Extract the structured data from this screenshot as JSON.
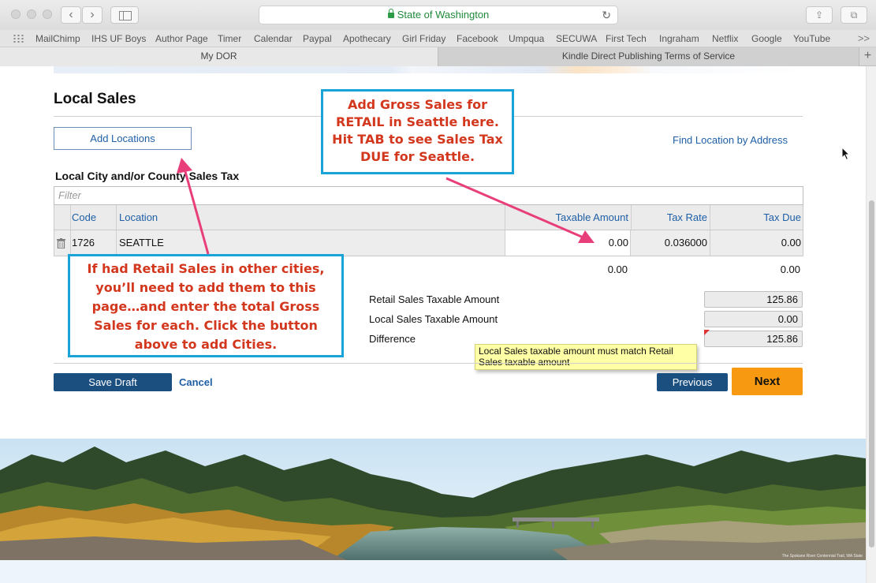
{
  "browser": {
    "address": "State of Washington",
    "bookmarks": [
      "MailChimp",
      "IHS UF Boys",
      "Author Page",
      "Timer",
      "Calendar",
      "Paypal",
      "Apothecary",
      "Girl Friday",
      "Facebook",
      "Umpqua",
      "SECUWA",
      "First Tech",
      "Ingraham",
      "Netflix",
      "Google",
      "YouTube"
    ],
    "bookmarks_more": ">>",
    "tabs": [
      {
        "label": "My DOR",
        "active": true
      },
      {
        "label": "Kindle Direct Publishing Terms of Service",
        "active": false
      }
    ],
    "new_tab": "+"
  },
  "page": {
    "title": "Local Sales",
    "add_locations": "Add Locations",
    "find_location": "Find Location by Address",
    "section_label": "Local City and/or County Sales Tax",
    "filter_placeholder": "Filter",
    "columns": {
      "code": "Code",
      "location": "Location",
      "taxable_amount": "Taxable Amount",
      "tax_rate": "Tax Rate",
      "tax_due": "Tax Due"
    },
    "rows": [
      {
        "code": "1726",
        "location": "SEATTLE",
        "taxable_amount": "0.00",
        "tax_rate": "0.036000",
        "tax_due": "0.00"
      }
    ],
    "totals": {
      "taxable_amount": "0.00",
      "tax_due": "0.00"
    },
    "summary": [
      {
        "label": "Retail Sales Taxable Amount",
        "value": "125.86"
      },
      {
        "label": "Local Sales Taxable Amount",
        "value": "0.00"
      },
      {
        "label": "Difference",
        "value": "125.86"
      }
    ],
    "tooltip": "Local Sales taxable amount must match Retail Sales taxable amount",
    "save_draft": "Save Draft",
    "cancel": "Cancel",
    "previous": "Previous",
    "next": "Next",
    "banner_caption": "The Spokane River Centennial Trail, WA State"
  },
  "annotations": {
    "top": [
      "Add Gross Sales for",
      "RETAIL in Seattle here.",
      "Hit TAB to see Sales Tax",
      "DUE for Seattle."
    ],
    "left": [
      "If had Retail Sales in other cities,",
      "you’ll need to add them to this",
      "page…and enter the total Gross",
      "Sales for each. Click the button",
      "above to add Cities."
    ]
  },
  "colors": {
    "link_blue": "#1e5fa6",
    "navy_button": "#1b4f80",
    "next_orange": "#f79a12",
    "annotation_red": "#d3371e",
    "annotation_border": "#1aa3d7",
    "arrow_pink": "#e83e7a"
  }
}
